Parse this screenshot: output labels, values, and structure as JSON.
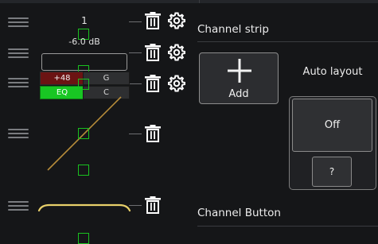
{
  "strip_preview": {
    "number": "1",
    "gain_db": "-6.0 dB",
    "phantom_label": "+48",
    "g_label": "G",
    "eq_label": "EQ",
    "c_label": "C"
  },
  "channel_strip_section": {
    "title": "Channel strip",
    "add_label": "Add",
    "auto_layout_label": "Auto layout",
    "auto_layout_value": "Off",
    "help_label": "?"
  },
  "channel_button_section": {
    "title": "Channel Button"
  },
  "colors": {
    "background": "#151618",
    "accent_green": "#18c623",
    "phantom_red": "#6b1313",
    "curve_yellow": "#e8d06a",
    "line_orange": "#b58b3a"
  },
  "icons": [
    "drag-handle-icon",
    "trash-icon",
    "gear-icon",
    "plus-icon"
  ]
}
